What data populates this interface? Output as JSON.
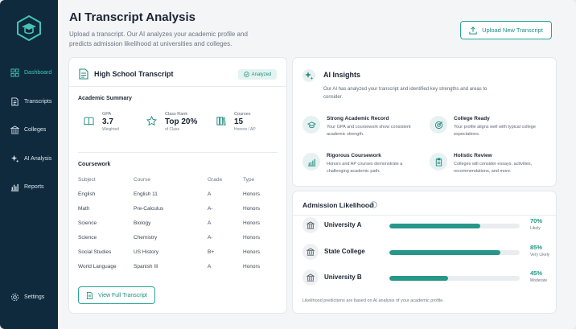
{
  "app": {
    "title": "AI Transcript Analysis",
    "subtitle": "Upload a transcript. Our AI analyzes your academic profile and predicts admission likelihood at universities and colleges.",
    "upload_label": "Upload New Transcript"
  },
  "sidebar": {
    "items": [
      {
        "label": "Dashboard",
        "icon": "dashboard-icon"
      },
      {
        "label": "Transcripts",
        "icon": "document-icon"
      },
      {
        "label": "Colleges",
        "icon": "building-icon"
      },
      {
        "label": "AI Analysis",
        "icon": "sparkle-icon"
      },
      {
        "label": "Reports",
        "icon": "bar-chart-icon"
      }
    ],
    "settings_label": "Settings",
    "active_index": 0
  },
  "transcript": {
    "title": "High School Transcript",
    "status": "Analyzed",
    "summary_label": "Academic Summary",
    "gpa": {
      "label": "GPA",
      "value": "3.7",
      "sub": "Weighted"
    },
    "rank": {
      "label": "Class Rank",
      "value": "Top 20%",
      "sub": "of Class"
    },
    "courses": {
      "label": "Courses",
      "value": "15",
      "sub": "Honors / AP"
    },
    "coursework_label": "Coursework",
    "columns": [
      "Subject",
      "Course",
      "Grade",
      "Type"
    ],
    "rows": [
      [
        "English",
        "English 11",
        "A",
        "Honors"
      ],
      [
        "Math",
        "Pre-Calculus",
        "A-",
        "Honors"
      ],
      [
        "Science",
        "Biology",
        "A",
        "Honors"
      ],
      [
        "Science",
        "Chemistry",
        "A-",
        "Honors"
      ],
      [
        "Social Studies",
        "US History",
        "B+",
        "Honors"
      ],
      [
        "World Language",
        "Spanish III",
        "A",
        "Honors"
      ]
    ],
    "view_label": "View Full Transcript"
  },
  "insights": {
    "title": "AI Insights",
    "description": "Our AI has analyzed your transcript and identified key strengths and areas to consider.",
    "items": [
      {
        "name": "Strong Academic Record",
        "text": "Your GPA and coursework show consistent academic strength.",
        "icon": "graduation-cap-icon"
      },
      {
        "name": "College Ready",
        "text": "Your profile aligns well with typical college expectations.",
        "icon": "target-icon"
      },
      {
        "name": "Rigorous Coursework",
        "text": "Honors and AP courses demonstrate a challenging academic path.",
        "icon": "trend-chart-icon"
      },
      {
        "name": "Holistic Review",
        "text": "Colleges will consider essays, activities, recommendations, and more.",
        "icon": "clipboard-icon"
      }
    ]
  },
  "admission": {
    "title": "Admission Likelihood",
    "universities": [
      {
        "name": "University A",
        "pct": "70%",
        "value": 70,
        "label": "Likely"
      },
      {
        "name": "State College",
        "pct": "85%",
        "value": 85,
        "label": "Very Likely"
      },
      {
        "name": "University B",
        "pct": "45%",
        "value": 45,
        "label": "Moderate"
      }
    ],
    "footnote": "Likelihood predictions are based on AI analysis of your academic profile."
  },
  "colors": {
    "sidebar": "#0f2a3d",
    "accent": "#26978a",
    "active_nav": "#46c4b3"
  }
}
